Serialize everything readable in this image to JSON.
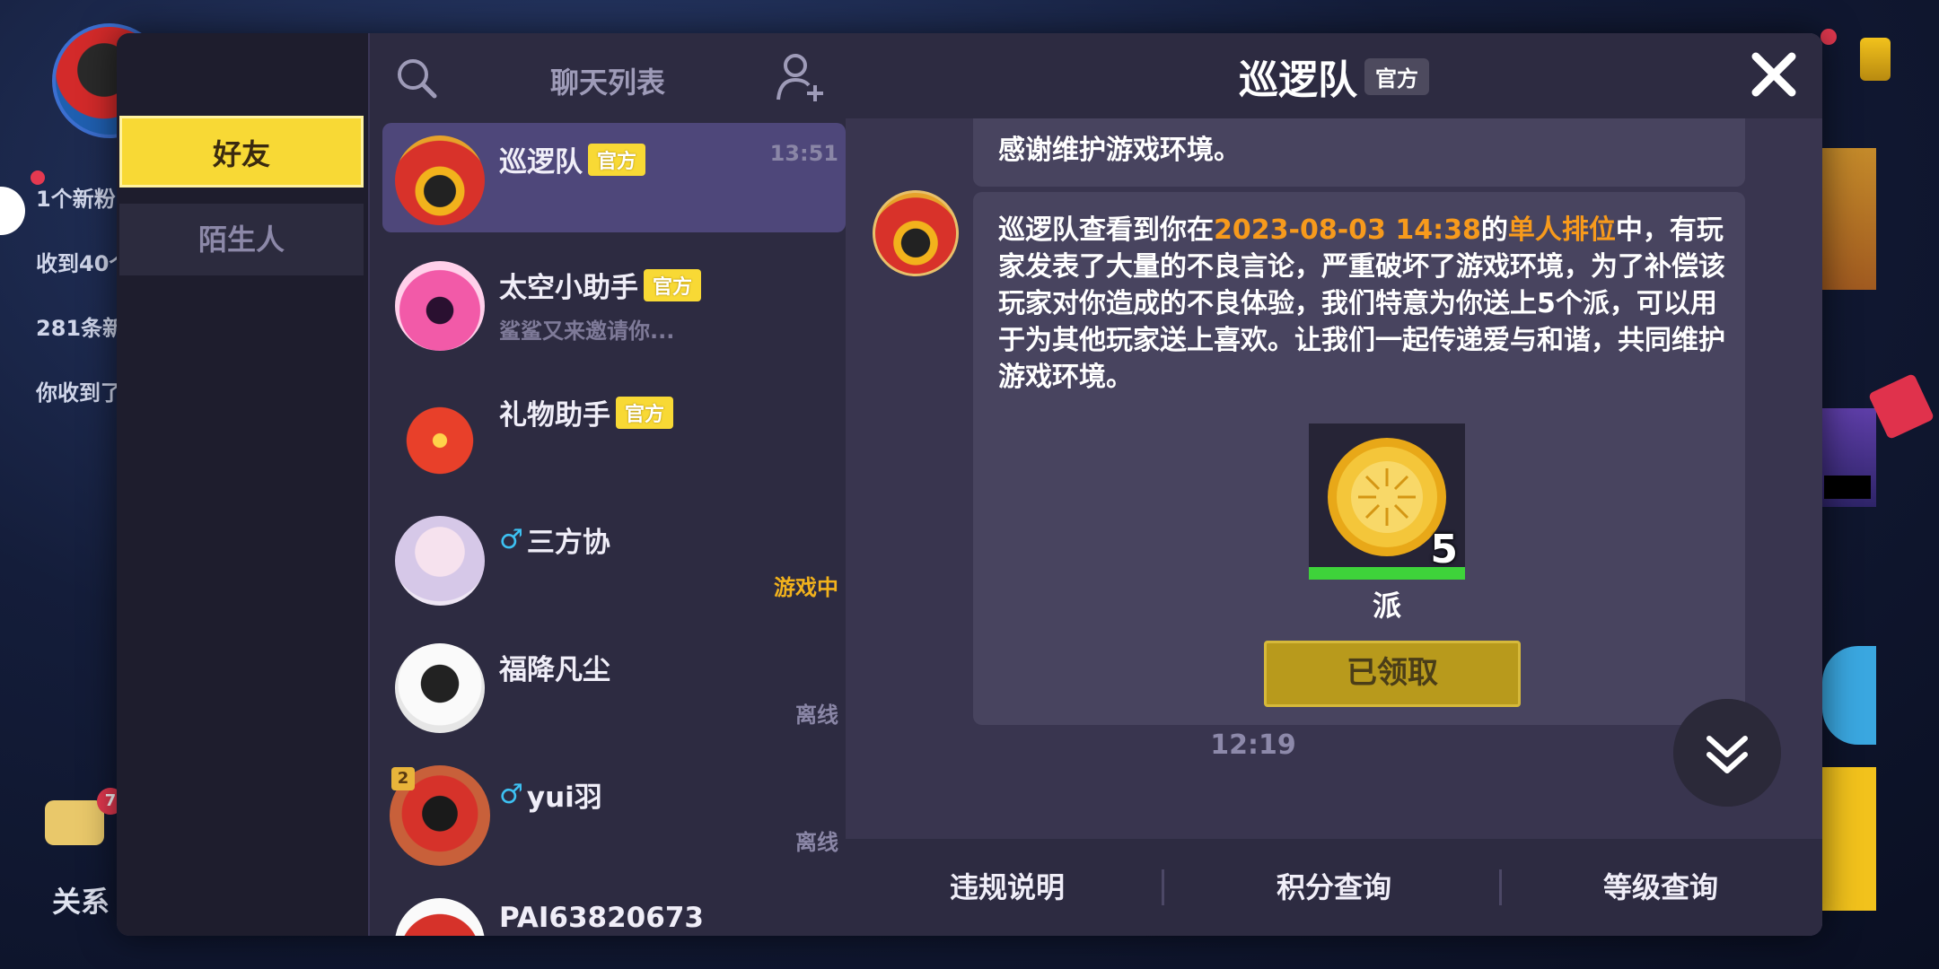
{
  "background": {
    "notices": [
      "1个新粉",
      "收到40个",
      "281条新",
      "你收到了"
    ],
    "chat_badge": "7",
    "relation_label": "关系"
  },
  "categories": [
    {
      "label": "好友",
      "active": true
    },
    {
      "label": "陌生人",
      "active": false
    }
  ],
  "chat_list": {
    "title": "聊天列表",
    "items": [
      {
        "name": "巡逻队",
        "tag": "官方",
        "time": "13:51",
        "preview": "",
        "status": ""
      },
      {
        "name": "太空小助手",
        "tag": "官方",
        "time": "",
        "preview": "鲨鲨又来邀请你...",
        "status": ""
      },
      {
        "name": "礼物助手",
        "tag": "官方",
        "time": "",
        "preview": "",
        "status": ""
      },
      {
        "name": "三方协",
        "gender": "♂",
        "status": "游戏中"
      },
      {
        "name": "福降凡尘",
        "status": "离线"
      },
      {
        "name": "yui羽",
        "gender": "♂",
        "status": "离线",
        "level": "2"
      },
      {
        "name": "PAI63820673"
      }
    ]
  },
  "chat": {
    "title": "巡逻队",
    "tag": "官方",
    "prev_message_tail": "感谢维护游戏环境。",
    "message": {
      "part1": "巡逻队查看到你在",
      "datetime": "2023-08-03 14:38",
      "part2": "的",
      "mode": "单人排位",
      "part3": "中，有玩家发表了大量的不良言论，严重破坏了游戏环境，为了补偿该玩家对你造成的不良体验，我们特意为你送上5个派，可以用于为其他玩家送上喜欢。让我们一起传递爱与和谐，共同维护游戏环境。"
    },
    "reward": {
      "name": "派",
      "count": "5"
    },
    "claim_button": "已领取",
    "time": "12:19"
  },
  "bottom_bar": [
    "违规说明",
    "积分查询",
    "等级查询"
  ],
  "colors": {
    "accent_yellow": "#f8d935",
    "highlight_orange": "#f79a1c",
    "male_blue": "#3dc1f2"
  }
}
